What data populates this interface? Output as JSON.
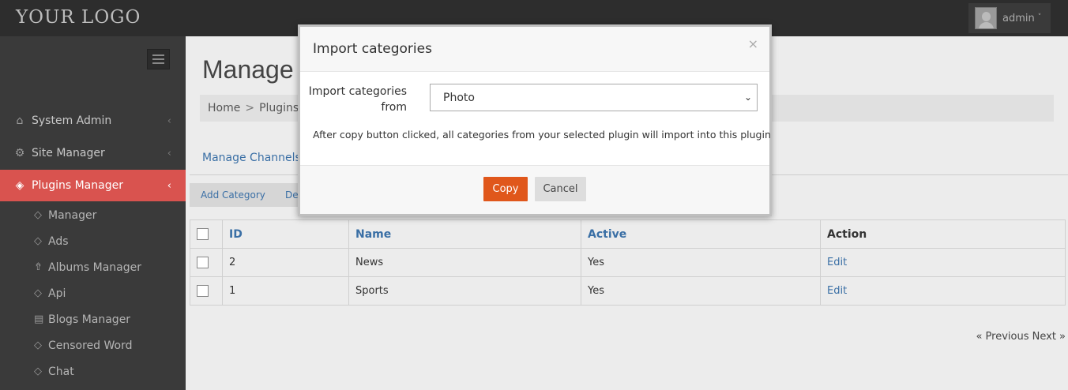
{
  "header": {
    "logo": "YOUR LOGO",
    "user_name": "admin",
    "user_caret": "˅"
  },
  "sidebar": {
    "items": [
      {
        "label": "System Admin",
        "icon": "home-icon",
        "arrow": "‹"
      },
      {
        "label": "Site Manager",
        "icon": "gears-icon",
        "arrow": "‹"
      },
      {
        "label": "Plugins Manager",
        "icon": "tag-icon",
        "arrow": "‹"
      }
    ],
    "subitems": [
      {
        "label": "Manager",
        "icon": "tag-icon"
      },
      {
        "label": "Ads",
        "icon": "tag-icon"
      },
      {
        "label": "Albums Manager",
        "icon": "photo-icon"
      },
      {
        "label": "Api",
        "icon": "tag-icon"
      },
      {
        "label": "Blogs Manager",
        "icon": "comment-icon"
      },
      {
        "label": "Censored Word",
        "icon": "tag-icon"
      },
      {
        "label": "Chat",
        "icon": "tag-icon"
      }
    ],
    "accent_color": "#d9534f"
  },
  "main": {
    "title": "Manage C",
    "breadcrumb": [
      "Home",
      "Plugins M"
    ],
    "breadcrumb_sep": ">",
    "tab": "Manage Channels",
    "actions": [
      "Add Category",
      "De"
    ],
    "table": {
      "headers": [
        "ID",
        "Name",
        "Active",
        "Action"
      ],
      "rows": [
        {
          "id": "2",
          "name": "News",
          "active": "Yes",
          "action": "Edit"
        },
        {
          "id": "1",
          "name": "Sports",
          "active": "Yes",
          "action": "Edit"
        }
      ]
    },
    "pager": "« Previous Next »"
  },
  "modal": {
    "title": "Import categories",
    "close": "×",
    "field_label": "Import categories from",
    "select_value": "Photo",
    "help_text": "After copy button clicked, all categories from your selected plugin will import into this plugin",
    "copy_label": "Copy",
    "cancel_label": "Cancel",
    "copy_color": "#e0571b"
  }
}
